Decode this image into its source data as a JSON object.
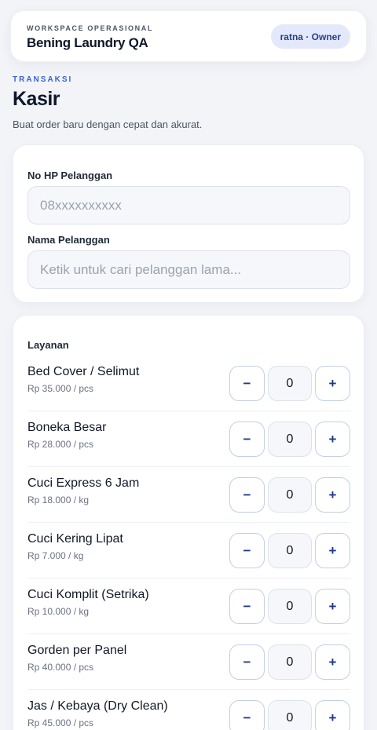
{
  "header": {
    "workspace_label": "WORKSPACE OPERASIONAL",
    "workspace_name": "Bening Laundry QA",
    "user_badge": "ratna · Owner"
  },
  "page": {
    "section_label": "TRANSAKSI",
    "title": "Kasir",
    "subtitle": "Buat order baru dengan cepat dan akurat."
  },
  "customer": {
    "phone_label": "No HP Pelanggan",
    "phone_placeholder": "08xxxxxxxxxx",
    "phone_value": "",
    "name_label": "Nama Pelanggan",
    "name_placeholder": "Ketik untuk cari pelanggan lama...",
    "name_value": ""
  },
  "services": {
    "title": "Layanan",
    "decrement_label": "−",
    "increment_label": "+",
    "items": [
      {
        "name": "Bed Cover / Selimut",
        "price": "Rp 35.000 / pcs",
        "qty": "0"
      },
      {
        "name": "Boneka Besar",
        "price": "Rp 28.000 / pcs",
        "qty": "0"
      },
      {
        "name": "Cuci Express 6 Jam",
        "price": "Rp 18.000 / kg",
        "qty": "0"
      },
      {
        "name": "Cuci Kering Lipat",
        "price": "Rp 7.000 / kg",
        "qty": "0"
      },
      {
        "name": "Cuci Komplit (Setrika)",
        "price": "Rp 10.000 / kg",
        "qty": "0"
      },
      {
        "name": "Gorden per Panel",
        "price": "Rp 40.000 / pcs",
        "qty": "0"
      },
      {
        "name": "Jas / Kebaya (Dry Clean)",
        "price": "Rp 45.000 / pcs",
        "qty": "0"
      }
    ]
  },
  "colors": {
    "accent": "#3b63d6",
    "badge_bg": "#e3e9fb",
    "background": "#f2f4f8"
  }
}
